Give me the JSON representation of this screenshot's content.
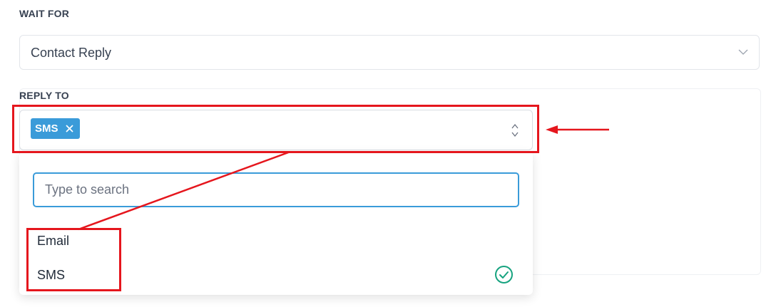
{
  "wait_for": {
    "label": "WAIT FOR",
    "value": "Contact Reply",
    "icon": "chevron-down-icon"
  },
  "reply_to": {
    "label": "REPLY TO",
    "selected_tags": [
      "SMS"
    ],
    "search_placeholder": "Type to search",
    "options": [
      {
        "label": "Email",
        "selected": false
      },
      {
        "label": "SMS",
        "selected": true
      }
    ]
  },
  "colors": {
    "accent": "#3a9bd9",
    "check": "#16a37f",
    "annotation": "#e5161d"
  }
}
